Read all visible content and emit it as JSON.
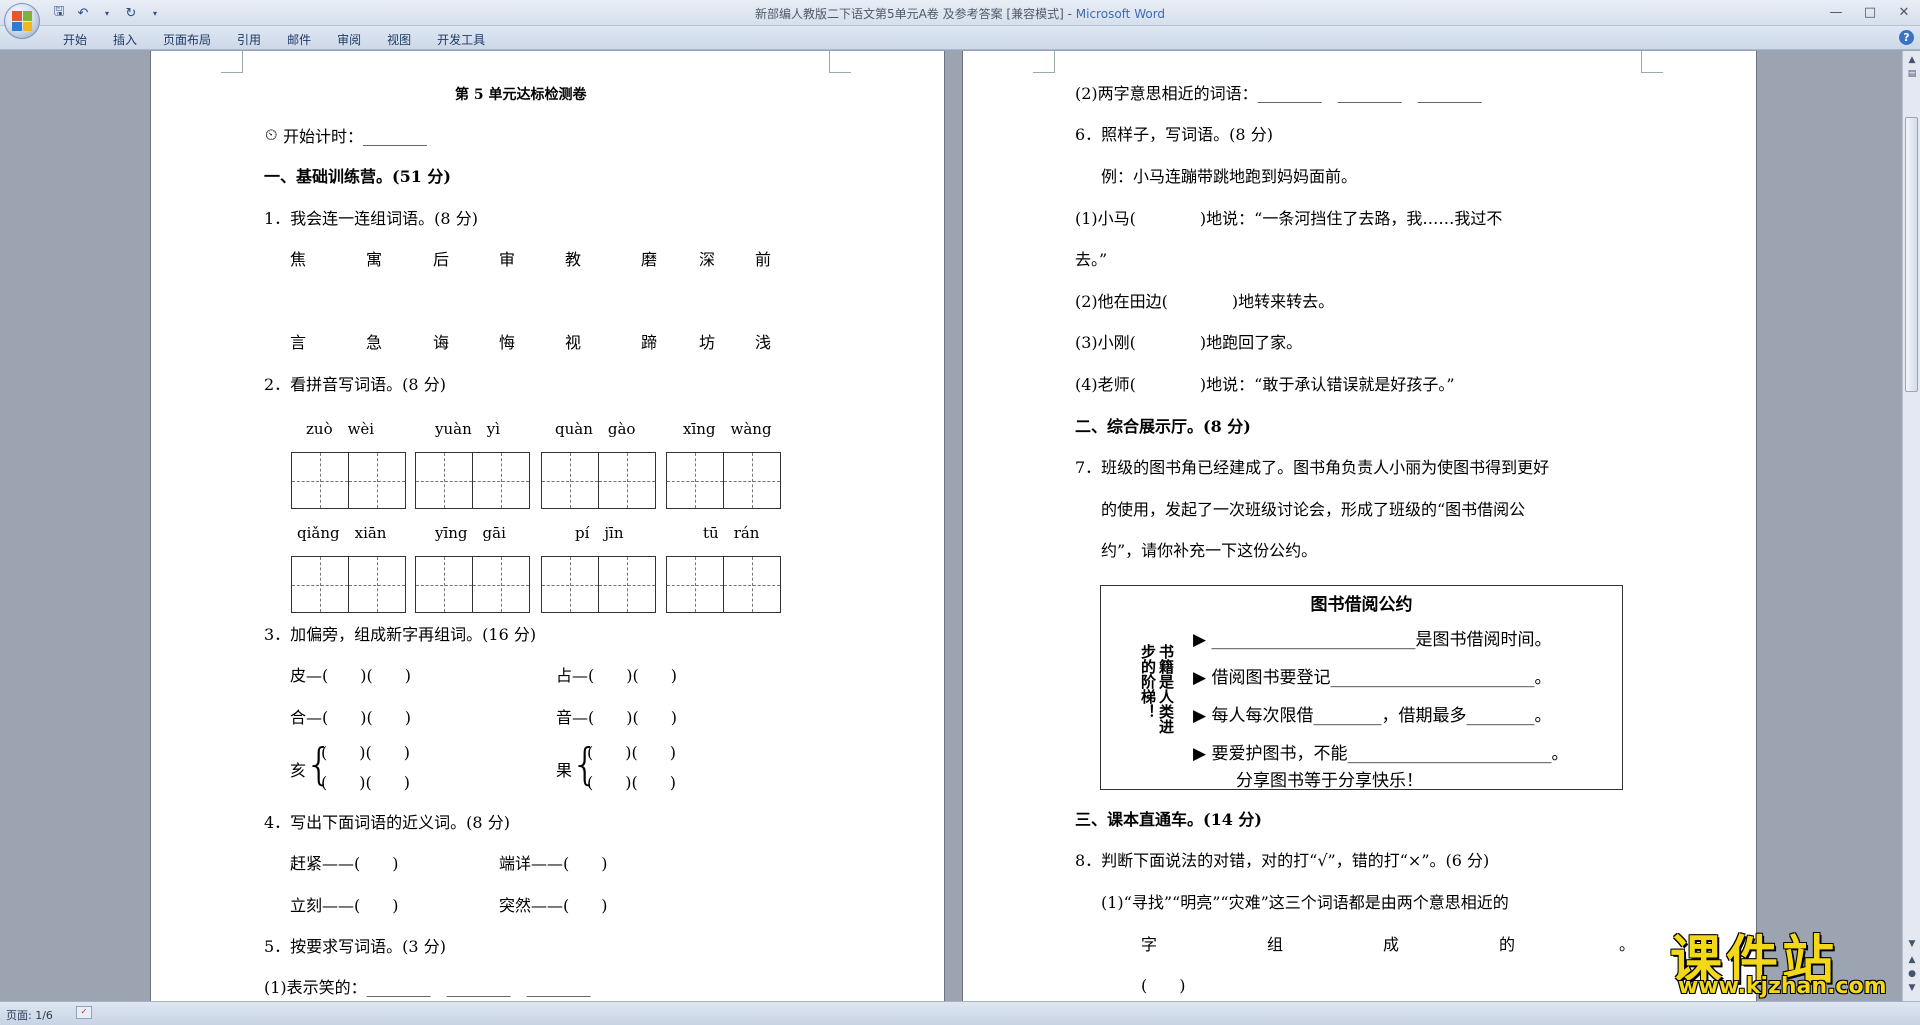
{
  "window": {
    "title": "新部编人教版二下语文第5单元A卷 及参考答案 [兼容模式]",
    "app_name": "Microsoft Word"
  },
  "ribbon": {
    "tabs": [
      "开始",
      "插入",
      "页面布局",
      "引用",
      "邮件",
      "审阅",
      "视图",
      "开发工具"
    ]
  },
  "status": {
    "page": "页面: 1/6"
  },
  "page1": {
    "title": "第 5 单元达标检测卷",
    "timer": "开始计时：________",
    "sec1": "一、基础训练营。(51 分)",
    "q1": "1．我会连一连组词语。(8 分)",
    "q1_row1": [
      "焦",
      "寓",
      "后",
      "审",
      "教",
      "磨",
      "深",
      "前"
    ],
    "q1_row2": [
      "言",
      "急",
      "诲",
      "悔",
      "视",
      "蹄",
      "坊",
      "浅"
    ],
    "q2": "2．看拼音写词语。(8 分)",
    "q2_pinyin_row1": [
      "zuò　wèi",
      "yuàn　yì",
      "quàn　gào",
      "xīng　wàng"
    ],
    "q2_pinyin_row2": [
      "qiǎng　xiān",
      "yīng　gāi",
      "pí　jīn",
      "tū　rán"
    ],
    "q3": "3．加偏旁，组成新字再组词。(16 分)",
    "q3_a1": "皮—(　　)(　　)",
    "q3_a2": "占—(　　)(　　)",
    "q3_b1": "合—(　　)(　　)",
    "q3_b2": "音—(　　)(　　)",
    "q3_c1_char": "亥",
    "q3_c2_char": "果",
    "q3_brace_line": "(　　)(　　)",
    "q4": "4．写出下面词语的近义词。(8 分)",
    "q4_a1": "赶紧——(　　)",
    "q4_a2": "端详——(　　)",
    "q4_b1": "立刻——(　　)",
    "q4_b2": "突然——(　　)",
    "q5": "5．按要求写词语。(3 分)",
    "q5_1": "(1)表示笑的：________　________　________"
  },
  "page2": {
    "q5_2": "(2)两字意思相近的词语：________　________　________",
    "q6": "6．照样子，写词语。(8 分)",
    "q6_example": "例：小马连蹦带跳地跑到妈妈面前。",
    "q6_1a": "(1)小马(　　　　)地说：“一条河挡住了去路，我……我过不",
    "q6_1b": "去。”",
    "q6_2": "(2)他在田边(　　　　)地转来转去。",
    "q6_3": "(3)小刚(　　　　)地跑回了家。",
    "q6_4": "(4)老师(　　　　)地说：“敢于承认错误就是好孩子。”",
    "sec2": "二、综合展示厅。(8 分)",
    "q7a": "7．班级的图书角已经建成了。图书角负责人小丽为使图书得到更好",
    "q7b": "的使用，发起了一次班级讨论会，形成了班级的“图书借阅公",
    "q7c": "约”，请你补充一下这份公约。",
    "convention": {
      "title": "图书借阅公约",
      "side": "书籍是人类进步的阶梯！",
      "lines": [
        "▶ ________________________是图书借阅时间。",
        "▶ 借阅图书要登记________________________。",
        "▶ 每人每次限借________，借期最多________。",
        "▶ 要爱护图书，不能________________________。"
      ],
      "footer": "分享图书等于分享快乐！"
    },
    "sec3": "三、课本直通车。(14 分)",
    "q8": "8．判断下面说法的对错，对的打“√”，错的打“×”。(6 分)",
    "q8_1a": "(1)“寻找”“明亮”“灾难”这三个词语都是由两个意思相近的",
    "q8_1b": [
      "字",
      "组",
      "成",
      "的",
      "。"
    ],
    "q8_1c": "(　　)"
  },
  "watermark": {
    "main": "课件站",
    "url": "www.kjzhan.com"
  }
}
